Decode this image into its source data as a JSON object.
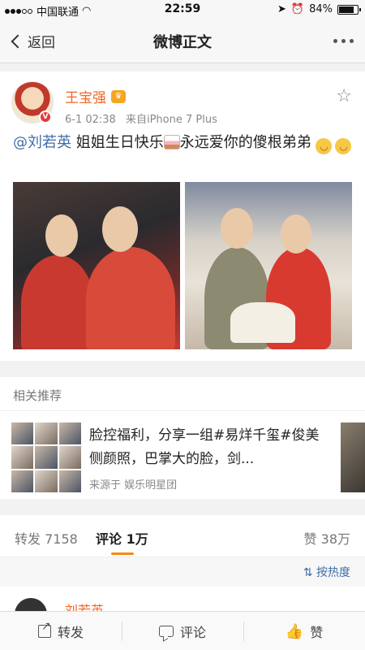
{
  "status_bar": {
    "carrier": "中国联通",
    "time": "22:59",
    "battery": "84%",
    "battery_level": 0.84
  },
  "nav": {
    "back_label": "返回",
    "title": "微博正文"
  },
  "post": {
    "author": "王宝强",
    "timestamp": "6-1 02:38",
    "source": "来自iPhone 7 Plus",
    "mention": "@刘若英",
    "text_1": " 姐姐生日快乐",
    "text_2": "永远爱你的傻根弟弟"
  },
  "related": {
    "header": "相关推荐",
    "title": "脸控福利，分享一组#易烊千玺#俊美侧颜照，巴掌大的脸，剑...",
    "source": "来源于 娱乐明星团"
  },
  "tabs": {
    "repost": "转发 7158",
    "comment": "评论 1万",
    "like": "赞 38万",
    "sort": "按热度"
  },
  "comment_peek": {
    "name": "刘若英"
  },
  "bottom_bar": {
    "repost": "转发",
    "comment": "评论",
    "like": "赞"
  },
  "colors": {
    "accent": "#f26522",
    "link": "#3e6ea7",
    "tab_underline": "#f7890f"
  }
}
